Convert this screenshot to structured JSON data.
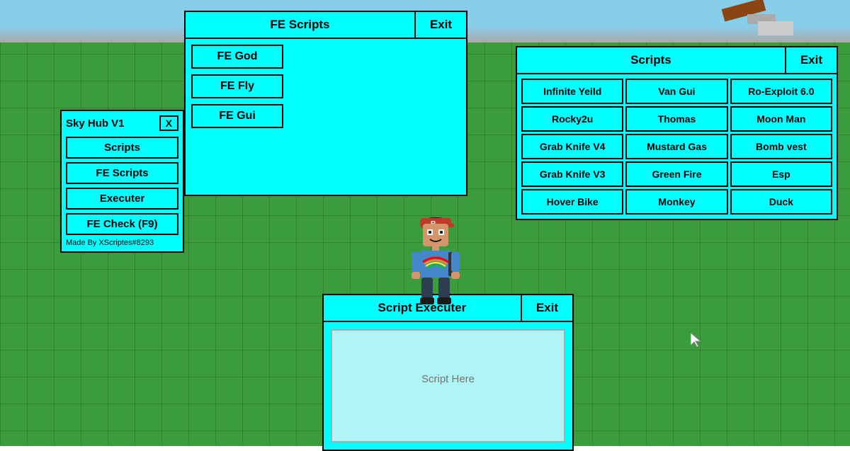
{
  "background": {
    "color": "#3a9c3a"
  },
  "skyhub_panel": {
    "title": "Sky Hub V1",
    "close_label": "X",
    "buttons": [
      {
        "label": "Scripts",
        "id": "scripts"
      },
      {
        "label": "FE Scripts",
        "id": "fescripts"
      },
      {
        "label": "Executer",
        "id": "executer"
      },
      {
        "label": "FE Check (F9)",
        "id": "fecheck"
      }
    ],
    "footer": "Made By XScriptes#8293"
  },
  "fescripts_panel": {
    "title": "FE Scripts",
    "exit_label": "Exit",
    "scripts": [
      {
        "label": "FE God"
      },
      {
        "label": "FE Fly"
      },
      {
        "label": "FE Gui"
      }
    ]
  },
  "scripts_panel": {
    "title": "Scripts",
    "exit_label": "Exit",
    "items": [
      "Infinite Yeild",
      "Van Gui",
      "Ro-Exploit 6.0",
      "Rocky2u",
      "Thomas",
      "Moon Man",
      "Grab Knife V4",
      "Mustard Gas",
      "Bomb vest",
      "Grab Knife V3",
      "Green Fire",
      "Esp",
      "Hover Bike",
      "Monkey",
      "Duck"
    ]
  },
  "executer_panel": {
    "title": "Script Executer",
    "exit_label": "Exit",
    "placeholder": "Script Here"
  }
}
